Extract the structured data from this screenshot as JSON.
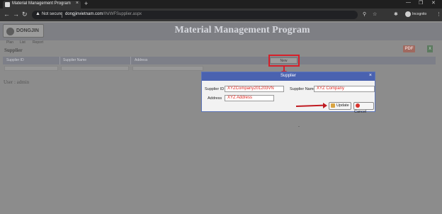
{
  "browser": {
    "tab_title": "Material Management Program",
    "tab_close": "×",
    "new_tab": "+",
    "minimize": "—",
    "maximize": "❐",
    "close": "✕",
    "back": "←",
    "forward": "→",
    "reload": "↻",
    "security_icon": "▲",
    "security_label": "Not secure",
    "url_host": "dongjinvietnam.com",
    "url_path": "/IN/WFSupplier.aspx",
    "key_icon": "⚲",
    "star_icon": "☆",
    "ext_icon": "✱",
    "incognito_label": "Incognito",
    "menu_icon": "⋮"
  },
  "app": {
    "logo_text": "DONGJIN",
    "title": "Material Management Program",
    "menu": [
      "Plan",
      "List",
      "Report"
    ],
    "section_title": "Supplier",
    "pdf_label": "PDF",
    "excel_label": "X",
    "grid_columns": [
      "Supplier ID",
      "Supplier Name",
      "Address"
    ],
    "new_button_label": "New",
    "user_label": "User : admin"
  },
  "dialog": {
    "title": "Supplier",
    "close": "×",
    "supplier_id_label": "Supplier ID",
    "supplier_id_value": "XYZCompany201203VN",
    "supplier_name_label": "Supplier Name",
    "supplier_name_value": "XYZ Company",
    "address_label": "Address",
    "address_value": "XYZ Address",
    "update_label": "Update",
    "cancel_label": "Cancel"
  },
  "colors": {
    "dialog_header": "#4a62b0",
    "annotation_red": "#d6202a",
    "input_text_red": "#e0261f"
  }
}
